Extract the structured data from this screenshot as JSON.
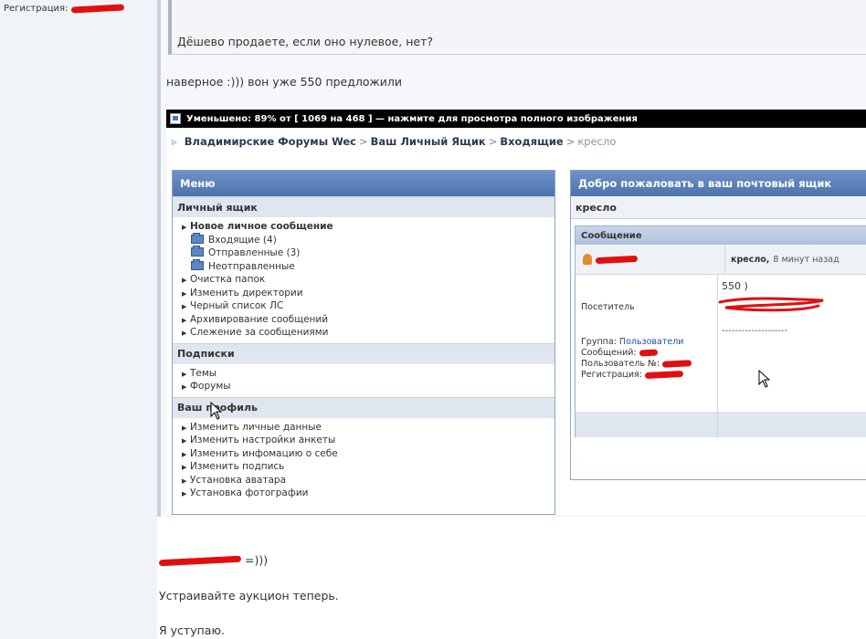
{
  "left": {
    "registration_label": "Регистрация:"
  },
  "quote": {
    "text": "Дёшево продаете, если оно нулевое, нет?"
  },
  "reply": {
    "text": "наверное :))) вон уже 550 предложили"
  },
  "image_bar": {
    "text": "Уменьшено: 89% от [ 1069 на 468 ] — нажмите для просмотра полного изображения"
  },
  "breadcrumb": {
    "items": [
      "Владимирские Форумы Wec",
      "Ваш Личный Ящик",
      "Входящие"
    ],
    "current": "кресло",
    "separator": ">"
  },
  "menu": {
    "title": "Меню",
    "sections": [
      {
        "title": "Личный ящик",
        "items": [
          "Новое личное сообщение",
          "Входящие (4)",
          "Отправленные (3)",
          "Неотправленные",
          "Очистка папок",
          "Изменить директории",
          "Черный список ЛС",
          "Архивирование сообщений",
          "Слежение за сообщениями"
        ]
      },
      {
        "title": "Подписки",
        "items": [
          "Темы",
          "Форумы"
        ]
      },
      {
        "title": "Ваш профиль",
        "items": [
          "Изменить личные данные",
          "Изменить настройки анкеты",
          "Изменить инфомацию о себе",
          "Изменить подпись",
          "Установка аватара",
          "Установка фотографии"
        ]
      }
    ]
  },
  "inbox": {
    "title": "Добро пожаловать в ваш почтовый ящик",
    "subject": "кресло",
    "message_header": "Сообщение",
    "msg_subject": "кресло,",
    "msg_time": "8 минут назад",
    "visitor_label": "Посетитель",
    "group_label": "Группа:",
    "group_value": "Пользователи",
    "messages_label": "Сообщений:",
    "user_no_label": "Пользователь №:",
    "registration_label": "Регистрация:",
    "body_line": "550 )",
    "body_divider": "--------------------"
  },
  "bottom": {
    "suffix": "=)))",
    "line2": "Устраивайте аукцион теперь.",
    "line3": "Я уступаю."
  },
  "colors": {
    "panel_header": "#4c72ab",
    "section_bg": "#dfe6ef",
    "redaction": "#e01010",
    "link": "#1d4fa6"
  }
}
